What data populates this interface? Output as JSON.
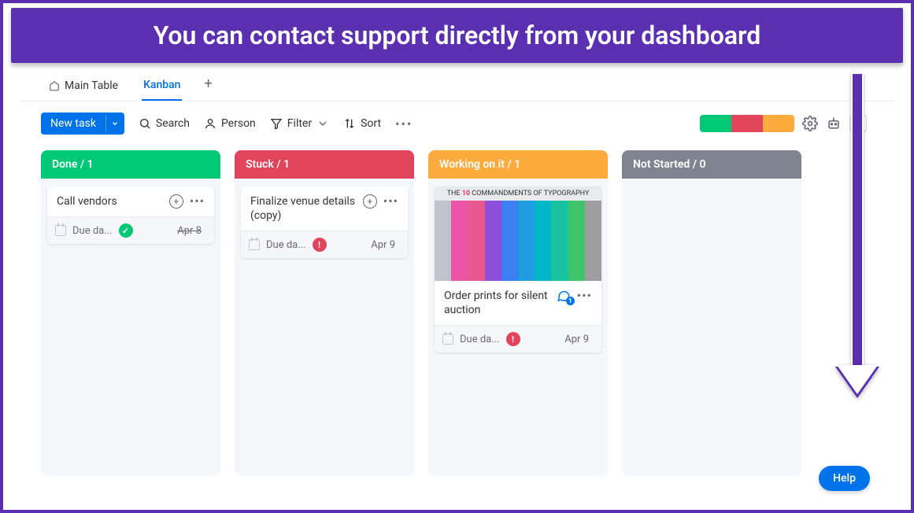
{
  "banner_text": "You can contact support directly from your dashboard",
  "tabs": {
    "main": "Main Table",
    "kanban": "Kanban"
  },
  "toolbar": {
    "new_task": "New task",
    "search": "Search",
    "person": "Person",
    "filter": "Filter",
    "sort": "Sort"
  },
  "columns": {
    "done": {
      "header": "Done / 1"
    },
    "stuck": {
      "header": "Stuck / 1"
    },
    "working": {
      "header": "Working on it / 1"
    },
    "notstarted": {
      "header": "Not Started / 0"
    }
  },
  "cards": {
    "vendors": {
      "title": "Call vendors",
      "due_label": "Due da...",
      "date": "Apr 8"
    },
    "venue": {
      "title": "Finalize venue details (copy)",
      "due_label": "Due da...",
      "date": "Apr 9"
    },
    "prints": {
      "thumb_pre": "THE ",
      "thumb_num": "10",
      "thumb_post": " COMMANDMENTS OF TYPOGRAPHY",
      "title": "Order prints for silent auction",
      "due_label": "Due da...",
      "date": "Apr 9",
      "chat_count": "1"
    }
  },
  "help_label": "Help"
}
